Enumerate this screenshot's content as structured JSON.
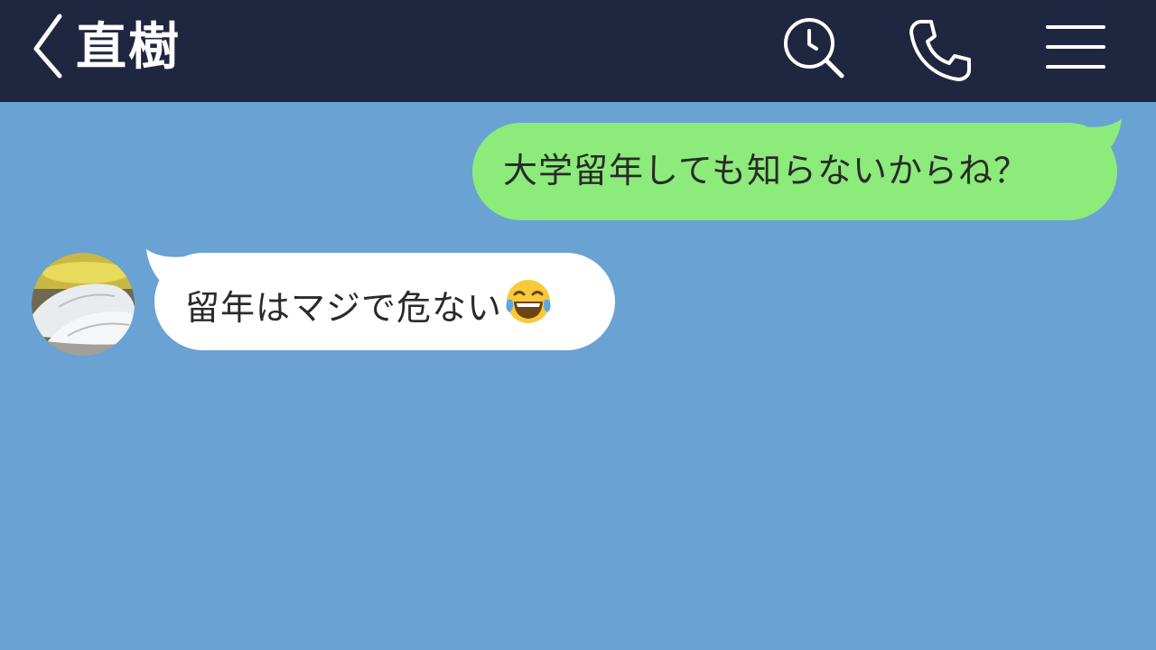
{
  "header": {
    "contact_name": "直樹",
    "back_icon": "chevron-left-icon",
    "search_icon": "search-history-icon",
    "call_icon": "phone-icon",
    "menu_icon": "hamburger-menu-icon",
    "background_color": "#1f2640"
  },
  "chat": {
    "background_color": "#6aa2d3",
    "messages": [
      {
        "direction": "outgoing",
        "text": "大学留年しても知らないからね？",
        "bubble_color": "#8ceb7b"
      },
      {
        "direction": "incoming",
        "text": "留年はマジで危ない",
        "emoji": "face-with-tears-of-joy-icon",
        "avatar": "sneakers-avatar",
        "bubble_color": "#ffffff"
      }
    ]
  }
}
